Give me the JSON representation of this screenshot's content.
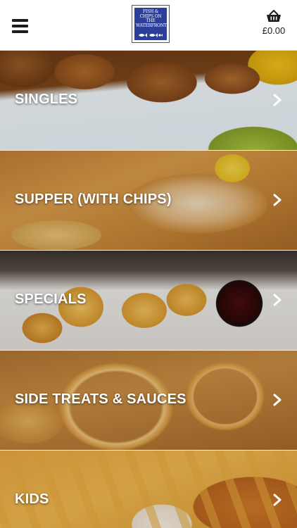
{
  "header": {
    "logo_text": "FISH & CHIPS ON THE WATERFRONT",
    "cart_total": "£0.00"
  },
  "icons": {
    "menu": "hamburger-menu-icon",
    "cart": "basket-icon",
    "chevron": "chevron-right-icon"
  },
  "categories": [
    {
      "label": "SINGLES"
    },
    {
      "label": "SUPPER (WITH CHIPS)"
    },
    {
      "label": "SPECIALS"
    },
    {
      "label": "SIDE TREATS & SAUCES"
    },
    {
      "label": "KIDS"
    }
  ],
  "colors": {
    "header_bg": "#ffffff",
    "logo_blue": "#2b3f9a",
    "label_text": "#ffffff"
  }
}
